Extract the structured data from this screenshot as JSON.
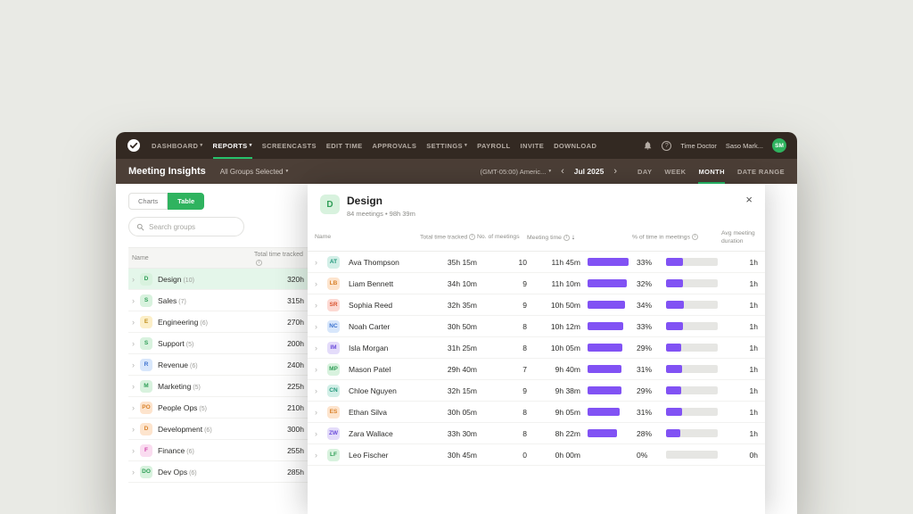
{
  "topnav": {
    "items": [
      {
        "label": "DASHBOARD",
        "caret": true,
        "active": false
      },
      {
        "label": "REPORTS",
        "caret": true,
        "active": true
      },
      {
        "label": "SCREENCASTS",
        "caret": false,
        "active": false
      },
      {
        "label": "EDIT TIME",
        "caret": false,
        "active": false
      },
      {
        "label": "APPROVALS",
        "caret": false,
        "active": false
      },
      {
        "label": "SETTINGS",
        "caret": true,
        "active": false
      },
      {
        "label": "PAYROLL",
        "caret": false,
        "active": false
      },
      {
        "label": "INVITE",
        "caret": false,
        "active": false
      },
      {
        "label": "DOWNLOAD",
        "caret": false,
        "active": false
      }
    ],
    "help_glyph": "?",
    "company": "Time Doctor",
    "user": "Saso Mark...",
    "avatar_initials": "SM"
  },
  "subnav": {
    "title": "Meeting Insights",
    "groups_selector": "All Groups Selected",
    "timezone": "(GMT-05:00) Americ...",
    "prev_glyph": "‹",
    "next_glyph": "›",
    "period": "Jul 2025",
    "tabs": [
      {
        "label": "DAY",
        "active": false
      },
      {
        "label": "WEEK",
        "active": false
      },
      {
        "label": "MONTH",
        "active": true
      },
      {
        "label": "DATE RANGE",
        "active": false
      }
    ]
  },
  "left_panel": {
    "toggle": {
      "charts": "Charts",
      "table": "Table"
    },
    "search_placeholder": "Search groups",
    "columns": {
      "name": "Name",
      "total": "Total time tracked"
    },
    "rows": [
      {
        "initial": "D",
        "name": "Design",
        "count": 10,
        "time": "320h",
        "color": "green",
        "selected": true
      },
      {
        "initial": "S",
        "name": "Sales",
        "count": 7,
        "time": "315h",
        "color": "green",
        "selected": false
      },
      {
        "initial": "E",
        "name": "Engineering",
        "count": 6,
        "time": "270h",
        "color": "yellow",
        "selected": false
      },
      {
        "initial": "S",
        "name": "Support",
        "count": 5,
        "time": "200h",
        "color": "green",
        "selected": false
      },
      {
        "initial": "R",
        "name": "Revenue",
        "count": 6,
        "time": "240h",
        "color": "blue",
        "selected": false
      },
      {
        "initial": "M",
        "name": "Marketing",
        "count": 5,
        "time": "225h",
        "color": "green",
        "selected": false
      },
      {
        "initial": "PO",
        "name": "People Ops",
        "count": 5,
        "time": "210h",
        "color": "orange",
        "selected": false
      },
      {
        "initial": "D",
        "name": "Development",
        "count": 6,
        "time": "300h",
        "color": "orange",
        "selected": false
      },
      {
        "initial": "F",
        "name": "Finance",
        "count": 6,
        "time": "255h",
        "color": "pink",
        "selected": false
      },
      {
        "initial": "DO",
        "name": "Dev Ops",
        "count": 6,
        "time": "285h",
        "color": "green",
        "selected": false
      }
    ]
  },
  "overlay": {
    "avatar_initial": "D",
    "title": "Design",
    "subtitle": "84 meetings • 98h 39m",
    "close_glyph": "×",
    "columns": {
      "name": "Name",
      "total": "Total time tracked",
      "meetings": "No. of meetings",
      "meeting_time": "Meeting time",
      "sort_glyph": "↓",
      "percent": "% of time in meetings",
      "avg": "Avg meeting duration"
    },
    "bar_color": "#8152f4",
    "meeting_time_max_minutes": 705,
    "rows": [
      {
        "initials": "AT",
        "color": "teal",
        "name": "Ava Thompson",
        "total_time": "35h 15m",
        "meetings": 10,
        "meeting_time": "11h 45m",
        "meeting_minutes": 705,
        "percent": 33,
        "avg": "1h"
      },
      {
        "initials": "LB",
        "color": "orange",
        "name": "Liam Bennett",
        "total_time": "34h 10m",
        "meetings": 9,
        "meeting_time": "11h 10m",
        "meeting_minutes": 670,
        "percent": 32,
        "avg": "1h"
      },
      {
        "initials": "SR",
        "color": "red",
        "name": "Sophia Reed",
        "total_time": "32h 35m",
        "meetings": 9,
        "meeting_time": "10h 50m",
        "meeting_minutes": 650,
        "percent": 34,
        "avg": "1h"
      },
      {
        "initials": "NC",
        "color": "blue",
        "name": "Noah Carter",
        "total_time": "30h 50m",
        "meetings": 8,
        "meeting_time": "10h 12m",
        "meeting_minutes": 612,
        "percent": 33,
        "avg": "1h"
      },
      {
        "initials": "IM",
        "color": "purple",
        "name": "Isla Morgan",
        "total_time": "31h 25m",
        "meetings": 8,
        "meeting_time": "10h 05m",
        "meeting_minutes": 605,
        "percent": 29,
        "avg": "1h"
      },
      {
        "initials": "MP",
        "color": "green",
        "name": "Mason Patel",
        "total_time": "29h 40m",
        "meetings": 7,
        "meeting_time": "9h 40m",
        "meeting_minutes": 580,
        "percent": 31,
        "avg": "1h"
      },
      {
        "initials": "CN",
        "color": "teal",
        "name": "Chloe Nguyen",
        "total_time": "32h 15m",
        "meetings": 9,
        "meeting_time": "9h 38m",
        "meeting_minutes": 578,
        "percent": 29,
        "avg": "1h"
      },
      {
        "initials": "ES",
        "color": "orange",
        "name": "Ethan Silva",
        "total_time": "30h 05m",
        "meetings": 8,
        "meeting_time": "9h 05m",
        "meeting_minutes": 545,
        "percent": 31,
        "avg": "1h"
      },
      {
        "initials": "ZW",
        "color": "purple",
        "name": "Zara Wallace",
        "total_time": "33h 30m",
        "meetings": 8,
        "meeting_time": "8h 22m",
        "meeting_minutes": 502,
        "percent": 28,
        "avg": "1h"
      },
      {
        "initials": "LF",
        "color": "green",
        "name": "Leo Fischer",
        "total_time": "30h 45m",
        "meetings": 0,
        "meeting_time": "0h 00m",
        "meeting_minutes": 0,
        "percent": 0,
        "avg": "0h"
      }
    ]
  }
}
